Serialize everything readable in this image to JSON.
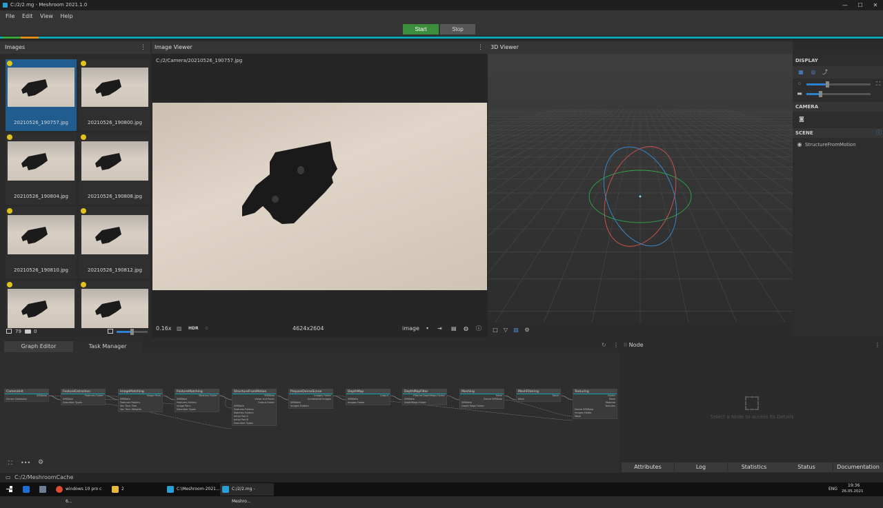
{
  "window": {
    "title": "C:/2/2.mg - Meshroom 2021.1.0",
    "minimize": "—",
    "maximize": "☐",
    "close": "✕"
  },
  "menu": [
    "File",
    "Edit",
    "View",
    "Help"
  ],
  "toolbar": {
    "start_label": "Start",
    "stop_label": "Stop"
  },
  "images_panel": {
    "title": "Images",
    "thumbnails": [
      {
        "caption": "20210526_190757.jpg",
        "selected": true
      },
      {
        "caption": "20210526_190800.jpg",
        "selected": false
      },
      {
        "caption": "20210526_190804.jpg",
        "selected": false
      },
      {
        "caption": "20210526_190808.jpg",
        "selected": false
      },
      {
        "caption": "20210526_190810.jpg",
        "selected": false
      },
      {
        "caption": "20210526_190812.jpg",
        "selected": false
      },
      {
        "caption": "",
        "selected": false
      },
      {
        "caption": "",
        "selected": false
      }
    ],
    "image_count": "79",
    "camera_count": "0"
  },
  "image_viewer": {
    "title": "Image Viewer",
    "path": "C:/2/Camera/20210526_190757.jpg",
    "zoom": "0.16x",
    "hdr_label": "HDR",
    "resolution": "4624x2604",
    "mode": "image"
  },
  "viewer_3d": {
    "title": "3D Viewer"
  },
  "display_panel": {
    "display_label": "DISPLAY",
    "camera_label": "CAMERA",
    "scene_label": "SCENE",
    "scene_item": "StructureFromMotion"
  },
  "graph": {
    "tabs": [
      "Graph Editor",
      "Task Manager"
    ],
    "nodes": [
      {
        "name": "CameraInit",
        "outputs": [
          "SfMData"
        ],
        "inputs": [
          "Sensor Database"
        ]
      },
      {
        "name": "FeatureExtraction",
        "outputs": [
          "Features Folder"
        ],
        "inputs": [
          "SfMData",
          "Describer Types"
        ]
      },
      {
        "name": "ImageMatching",
        "outputs": [
          "Image Pairs"
        ],
        "inputs": [
          "SfMData",
          "Features Folders",
          "Voc Tree: Tree",
          "Voc Tree: Weights"
        ]
      },
      {
        "name": "FeatureMatching",
        "outputs": [
          "Matches Folder"
        ],
        "inputs": [
          "SfMData",
          "Features Folders",
          "Image Pairs",
          "Describer Types"
        ]
      },
      {
        "name": "StructureFromMotion",
        "outputs": [
          "SfMData",
          "Views and Poses",
          "Output Folder"
        ],
        "inputs": [
          "SfMData",
          "Features Folders",
          "Matches Folders",
          "Initial Pair A",
          "Initial Pair B",
          "Describer Types"
        ]
      },
      {
        "name": "PrepareDenseScene",
        "outputs": [
          "Images Folder",
          "Undistorted Images"
        ],
        "inputs": [
          "SfMData",
          "Images Folders"
        ]
      },
      {
        "name": "DepthMap",
        "outputs": [
          "Output"
        ],
        "inputs": [
          "SfMData",
          "Images Folder"
        ]
      },
      {
        "name": "DepthMapFilter",
        "outputs": [
          "Filtered DepthMaps Folder"
        ],
        "inputs": [
          "SfMData",
          "DepthMaps Folder"
        ]
      },
      {
        "name": "Meshing",
        "outputs": [
          "Mesh",
          "Dense SfMData"
        ],
        "inputs": [
          "SfMData",
          "Depth Maps Folder"
        ]
      },
      {
        "name": "MeshFiltering",
        "outputs": [
          "Mesh"
        ],
        "inputs": [
          "Mesh"
        ]
      },
      {
        "name": "Texturing",
        "outputs": [
          "Folder",
          "Mesh",
          "Material",
          "Textures"
        ],
        "inputs": [
          "Dense SfMData",
          "Images Folder",
          "Mesh"
        ]
      }
    ]
  },
  "node_panel": {
    "title": "Node",
    "hint": "Select a Node to access its Details",
    "tabs": [
      "Attributes",
      "Log",
      "Statistics",
      "Status",
      "Documentation"
    ]
  },
  "status_path": "C:/2/MeshroomCache",
  "taskbar": {
    "items": [
      "windows 10 pro c 6...",
      "2",
      "C:\\Meshroom-2021...",
      "C:/2/2.mg - Meshro..."
    ],
    "lang": "ENG",
    "time": "19:36",
    "date": "26.05.2021"
  },
  "colors": {
    "accent": "#0ea7b5",
    "start": "#3c8e3c",
    "selected": "#215c8f"
  }
}
